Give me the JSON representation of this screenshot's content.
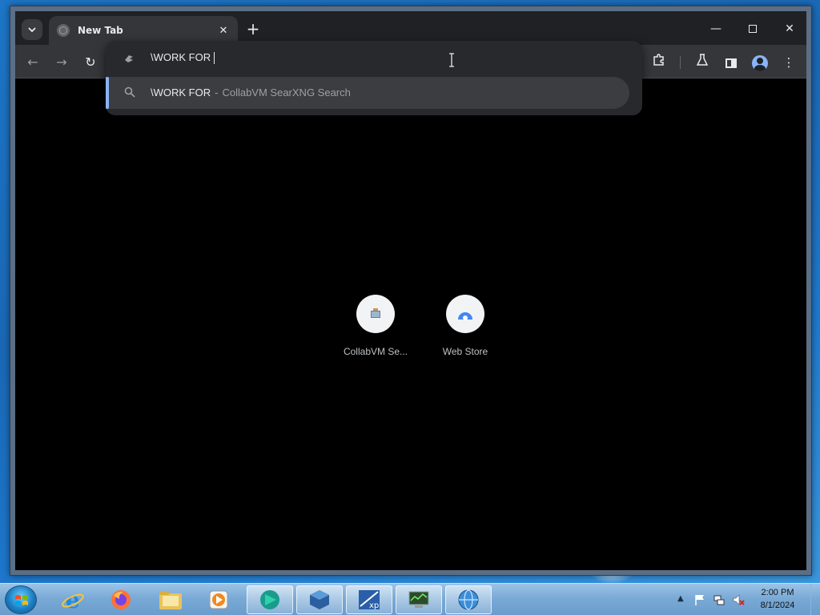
{
  "browser": {
    "tab": {
      "title": "New Tab",
      "close_glyph": "✕"
    },
    "new_tab_glyph": "+",
    "window_controls": {
      "minimize": "—",
      "close": "✕"
    },
    "toolbar": {
      "back_glyph": "←",
      "forward_glyph": "→",
      "reload_glyph": "↻",
      "menu_glyph": "⋮"
    },
    "omnibox": {
      "input_value": "\\WORK FOR",
      "suggestion": {
        "query": "\\WORK FOR",
        "separator": "-",
        "engine": "CollabVM SearXNG Search"
      }
    },
    "shortcuts": [
      {
        "label": "CollabVM Se..."
      },
      {
        "label": "Web Store"
      }
    ]
  },
  "taskbar": {
    "clock": {
      "time": "2:00 PM",
      "date": "8/1/2024"
    },
    "tray_arrow": "▲"
  },
  "colors": {
    "accent": "#8ab4f8",
    "titlebar": "#202124",
    "toolbar": "#35363a",
    "omnibox": "#28292c",
    "suggestion_bg": "#3c3d41"
  }
}
